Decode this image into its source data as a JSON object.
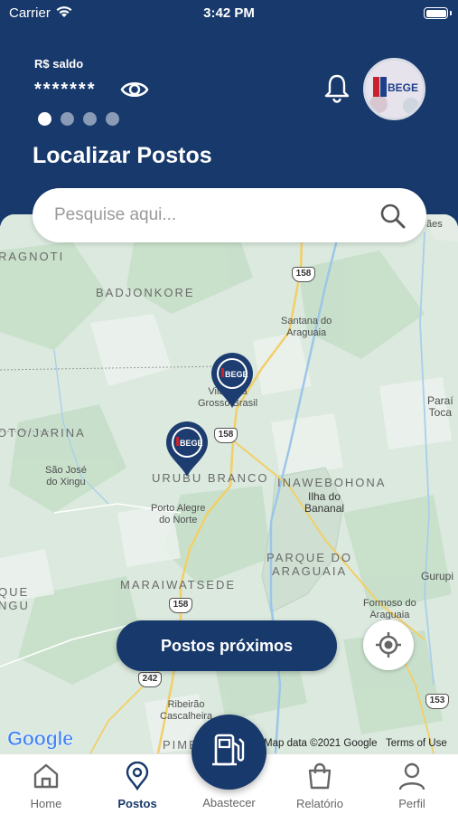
{
  "status_bar": {
    "carrier": "Carrier",
    "time": "3:42 PM"
  },
  "header": {
    "balance_label": "R$ saldo",
    "balance_value": "*******",
    "page_title": "Localizar Postos",
    "avatar_text": "BEGE"
  },
  "search": {
    "placeholder": "Pesquise aqui..."
  },
  "map": {
    "labels": {
      "ragnoti": "RAGNOTI",
      "badjonkore": "BADJONKORE",
      "santana": "Santana do\nAraguaia",
      "vila_rica": "Vila Rica\nGrosso Brasil",
      "to_jarina": "OTO/JARINA",
      "sao_jose": "São José\ndo Xingu",
      "urubu": "URUBU BRANCO",
      "inawebohona": "INAWEBOHONA",
      "ilha": "Ilha do\nBananal",
      "porto_alegre": "Porto Alegre\ndo Norte",
      "parque": "PARQUE DO\nARAGUAIA",
      "maraiwatsede": "MARAIWATSEDE",
      "paraiso": "Paraí\nToca",
      "gurupi": "Gurupi",
      "formoso": "Formoso do\nAraguaia",
      "ribeirao": "Ribeirão\nCascalheira",
      "que": "QUE\nNGU",
      "pimen": "PIMEN",
      "aes": "ães"
    },
    "roads": {
      "r158a": "158",
      "r158b": "158",
      "r158c": "158",
      "r242": "242",
      "r153": "153"
    },
    "pin_brand": "BEGE",
    "google": "Google",
    "copyright": "Map data ©2021 Google",
    "terms": "Terms of Use"
  },
  "actions": {
    "nearby": "Postos próximos"
  },
  "tabs": {
    "home": "Home",
    "postos": "Postos",
    "abastecer": "Abastecer",
    "relatorio": "Relatório",
    "perfil": "Perfil"
  },
  "colors": {
    "brand": "#18396b",
    "map_bg": "#dbe9de",
    "active_dot": "#ffffff",
    "inactive_dot": "#8a9bb8"
  },
  "icons": [
    "wifi-icon",
    "battery-icon",
    "eye-icon",
    "bell-icon",
    "search-icon",
    "location-pin-icon",
    "crosshair-icon",
    "fuel-pump-icon",
    "home-icon",
    "profile-icon",
    "shopping-bag-icon"
  ],
  "carousel": {
    "total": 4,
    "active_index": 0
  }
}
